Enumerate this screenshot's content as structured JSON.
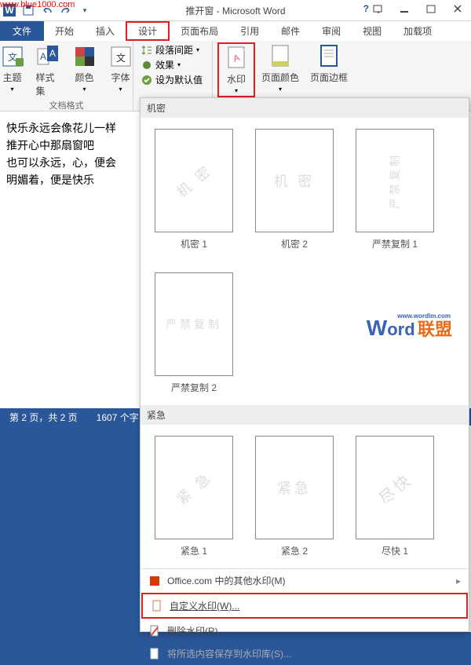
{
  "site_url": "www.blue1000.com",
  "title": "推开窗 - Microsoft Word",
  "tabs": {
    "file": "文件",
    "home": "开始",
    "insert": "插入",
    "design": "设计",
    "layout": "页面布局",
    "references": "引用",
    "mail": "邮件",
    "review": "审阅",
    "view": "视图",
    "addins": "加载项"
  },
  "ribbon": {
    "themes": "主题",
    "style_set": "样式集",
    "colors": "颜色",
    "fonts": "字体",
    "para_spacing": "段落间距",
    "effects": "效果",
    "set_default": "设为默认值",
    "watermark": "水印",
    "page_color": "页面颜色",
    "page_border": "页面边框",
    "group_doc_format": "文档格式"
  },
  "doc": {
    "l1": "快乐永远会像花儿一样",
    "l2": "    推开心中那扇窗吧",
    "l3": "也可以永远，心，便会",
    "l4": "    明媚着，便是快乐"
  },
  "status": {
    "page": "第 2 页，共 2 页",
    "words": "1607 个字"
  },
  "gallery": {
    "h1": "机密",
    "h2": "紧急",
    "items1": [
      {
        "wm": "机 密",
        "lbl": "机密 1"
      },
      {
        "wm": "机 密",
        "lbl": "机密 2"
      },
      {
        "wm": "严禁复制",
        "lbl": "严禁复制 1"
      }
    ],
    "items2": [
      {
        "wm": "严禁复制",
        "lbl": "严禁复制 2"
      }
    ],
    "items3": [
      {
        "wm": "紧 急",
        "lbl": "紧急 1"
      },
      {
        "wm": "紧急",
        "lbl": "紧急 2"
      },
      {
        "wm": "尽快",
        "lbl": "尽快 1"
      }
    ],
    "more": "Office.com 中的其他水印(M)",
    "custom": "自定义水印(W)...",
    "remove": "删除水印(R)",
    "save": "将所选内容保存到水印库(S)..."
  },
  "wordlm": {
    "w": "W",
    "ord": "ord",
    "lm": "联盟",
    "url": "www.wordlm.com"
  }
}
